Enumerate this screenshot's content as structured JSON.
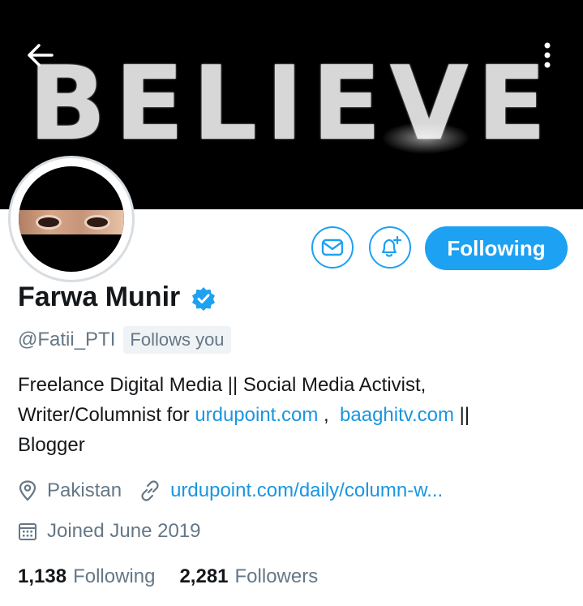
{
  "banner": {
    "text": "BELIEVE"
  },
  "profile": {
    "name": "Farwa Munir",
    "handle": "@Fatii_PTI",
    "follows_you": "Follows you",
    "bio_line1": "Freelance Digital Media || Social Media Activist,",
    "bio_line2_prefix": "Writer/Columnist for ",
    "bio_link1": "urdupoint.com",
    "bio_sep": " ,  ",
    "bio_link2": "baaghitv.com",
    "bio_line2_suffix": " ||",
    "bio_line3": "Blogger",
    "location": "Pakistan",
    "website": "urdupoint.com/daily/column-w...",
    "joined": "Joined June 2019"
  },
  "stats": {
    "following_count": "1,138",
    "following_label": "Following",
    "followers_count": "2,281",
    "followers_label": "Followers"
  },
  "actions": {
    "following_button": "Following"
  },
  "icons": {
    "back": "arrow-left-icon",
    "more": "more-vertical-icon",
    "message": "mail-icon",
    "notify": "bell-plus-icon",
    "verified": "verified-badge-icon",
    "location": "location-pin-icon",
    "link": "link-icon",
    "calendar": "calendar-icon"
  },
  "colors": {
    "accent": "#1da1f2",
    "link": "#1b95e0",
    "secondary_text": "#657786"
  }
}
